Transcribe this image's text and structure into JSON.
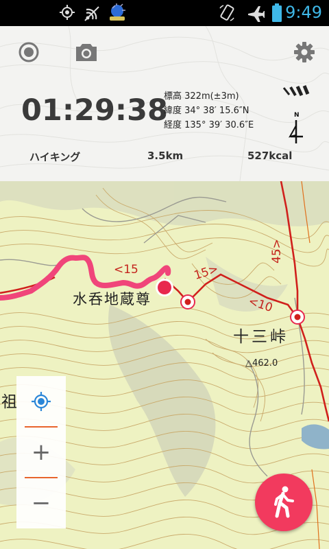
{
  "status_bar": {
    "time": "9:49",
    "icons": [
      "gps-icon",
      "wifi-broadcast-icon",
      "app-notification-icon",
      "rotate-icon",
      "airplane-icon",
      "battery-icon"
    ]
  },
  "toolbar": {
    "record_icon": "record-icon",
    "camera_icon": "camera-icon",
    "settings_icon": "gear-icon"
  },
  "tracking": {
    "elapsed": "01:29:38",
    "altitude": "標高 322m(±3m)",
    "latitude": "緯度 34° 38′ 15.6″N",
    "longitude": "経度 135° 39′ 30.6″E",
    "compass_label": "N"
  },
  "stats": {
    "activity": "ハイキング",
    "distance": "3.5km",
    "calories": "527kcal"
  },
  "map": {
    "labels": {
      "place_1": "水呑地蔵尊",
      "place_2": "十三峠",
      "place_3": "祖",
      "summit": "△462.0",
      "slope_1": "<15",
      "slope_2": "15>",
      "slope_3": "<10",
      "slope_4": "45>"
    },
    "colors": {
      "track": "#f0457a",
      "route": "#d0201c",
      "map_bg": "#eef2c2",
      "accent": "#f23a5e"
    }
  },
  "zoom": {
    "locate_icon": "my-location-icon",
    "zoom_in": "+",
    "zoom_out": "−"
  },
  "fab": {
    "icon": "walking-person-icon"
  }
}
